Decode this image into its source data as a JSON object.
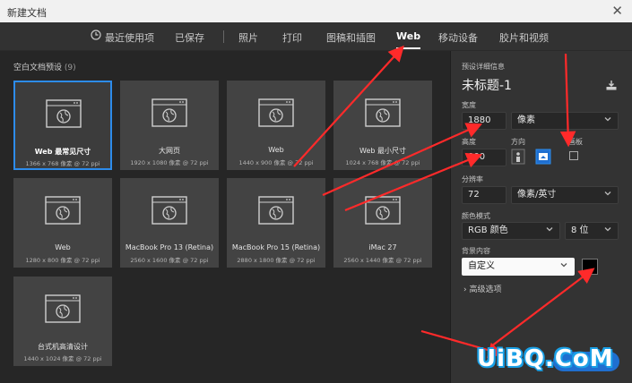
{
  "window": {
    "title": "新建文档",
    "close_glyph": "✕"
  },
  "tabs": [
    {
      "label": "最近使用项",
      "icon": "clock-icon"
    },
    {
      "label": "已保存"
    },
    {
      "label": "照片"
    },
    {
      "label": "打印"
    },
    {
      "label": "图稿和插图"
    },
    {
      "label": "Web",
      "active": true
    },
    {
      "label": "移动设备"
    },
    {
      "label": "胶片和视频"
    }
  ],
  "presets_section": {
    "title": "空白文档预设",
    "count": "(9)"
  },
  "presets": [
    {
      "name": "Web 最常见尺寸",
      "dims": "1366 x 768 像素 @ 72 ppi",
      "selected": true
    },
    {
      "name": "大网页",
      "dims": "1920 x 1080 像素 @ 72 ppi"
    },
    {
      "name": "Web",
      "dims": "1440 x 900 像素 @ 72 ppi"
    },
    {
      "name": "Web 最小尺寸",
      "dims": "1024 x 768 像素 @ 72 ppi"
    },
    {
      "name": "Web",
      "dims": "1280 x 800 像素 @ 72 ppi"
    },
    {
      "name": "MacBook Pro 13 (Retina)",
      "dims": "2560 x 1600 像素 @ 72 ppi"
    },
    {
      "name": "MacBook Pro 15 (Retina)",
      "dims": "2880 x 1800 像素 @ 72 ppi"
    },
    {
      "name": "iMac 27",
      "dims": "2560 x 1440 像素 @ 72 ppi"
    },
    {
      "name": "台式机高清设计",
      "dims": "1440 x 1024 像素 @ 72 ppi"
    }
  ],
  "details": {
    "section_label": "预设详细信息",
    "doc_title": "未标题-1",
    "width_label": "宽度",
    "width_value": "1880",
    "width_unit": "像素",
    "height_label": "高度",
    "height_value": "800",
    "orientation_label": "方向",
    "artboard_label": "画板",
    "resolution_label": "分辨率",
    "resolution_value": "72",
    "resolution_unit": "像素/英寸",
    "color_mode_label": "颜色模式",
    "color_mode_value": "RGB 颜色",
    "bit_depth_value": "8 位",
    "background_label": "背景内容",
    "background_value": "自定义",
    "background_color": "#000000",
    "advanced_label": "高级选项"
  },
  "watermark": {
    "text": "UiBQ.CoM"
  },
  "colors": {
    "accent": "#2d8ceb",
    "annotation": "#ff2a2a"
  }
}
